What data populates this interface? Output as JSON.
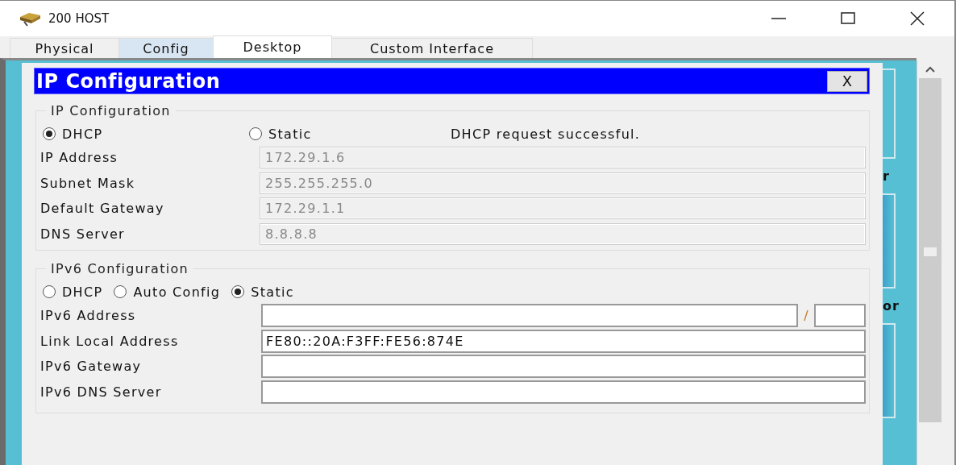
{
  "window": {
    "title": "200 HOST"
  },
  "tabs": [
    {
      "label": "Physical",
      "selected": false,
      "highlighted": false
    },
    {
      "label": "Config",
      "selected": false,
      "highlighted": true
    },
    {
      "label": "Desktop",
      "selected": true,
      "highlighted": false
    },
    {
      "label": "Custom Interface",
      "selected": false,
      "highlighted": false
    }
  ],
  "dialog": {
    "title": "IP Configuration",
    "close_label": "X"
  },
  "ipv4": {
    "legend": "IP Configuration",
    "status": "DHCP request successful.",
    "modes": [
      {
        "label": "DHCP",
        "selected": true
      },
      {
        "label": "Static",
        "selected": false
      }
    ],
    "fields": [
      {
        "label": "IP Address",
        "value": "172.29.1.6",
        "disabled": true
      },
      {
        "label": "Subnet Mask",
        "value": "255.255.255.0",
        "disabled": true
      },
      {
        "label": "Default Gateway",
        "value": "172.29.1.1",
        "disabled": true
      },
      {
        "label": "DNS Server",
        "value": "8.8.8.8",
        "disabled": true
      }
    ]
  },
  "ipv6": {
    "legend": "IPv6 Configuration",
    "modes": [
      {
        "label": "DHCP",
        "selected": false
      },
      {
        "label": "Auto Config",
        "selected": false
      },
      {
        "label": "Static",
        "selected": true
      }
    ],
    "fields": [
      {
        "label": "IPv6 Address",
        "kind": "prefixed",
        "separator": "/",
        "disabled": false
      },
      {
        "label": "Link Local Address",
        "kind": "text",
        "value": "FE80::20A:F3FF:FE56:874E",
        "disabled": false
      },
      {
        "label": "IPv6 Gateway",
        "kind": "text",
        "disabled": false
      },
      {
        "label": "IPv6 DNS Server",
        "kind": "text",
        "disabled": false
      }
    ]
  },
  "background_fragments": [
    "r",
    "or"
  ]
}
